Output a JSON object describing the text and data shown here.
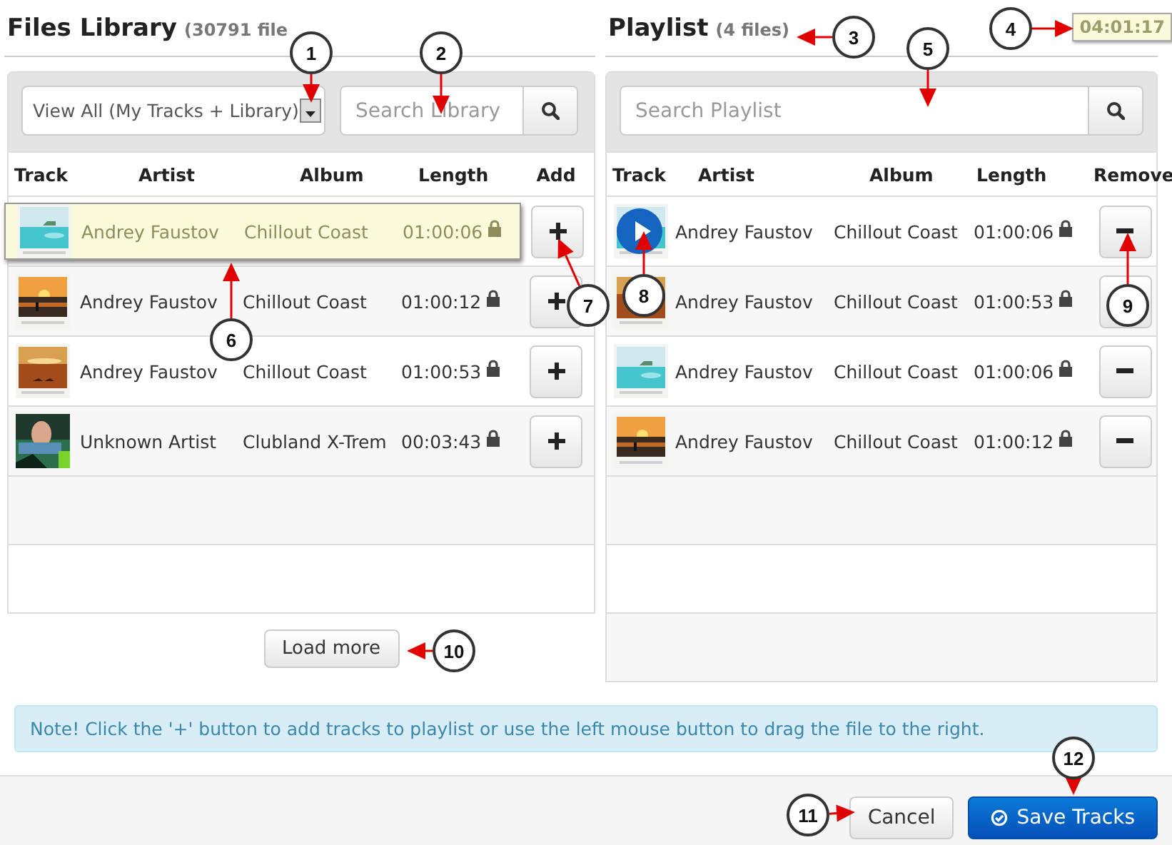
{
  "files_library": {
    "title": "Files Library",
    "count": "(30791 file",
    "filter": {
      "value": "View All (My Tracks + Library)"
    },
    "search": {
      "placeholder": "Search Library"
    },
    "columns": [
      "Track",
      "Artist",
      "Album",
      "Length",
      "Add"
    ],
    "rows": [
      {
        "artist": "Andrey Faustov",
        "album": "Chillout Coast",
        "length": "01:00:06",
        "locked": true,
        "dragging": true
      },
      {
        "artist": "Andrey Faustov",
        "album": "Chillout Coast",
        "length": "01:00:12",
        "locked": true,
        "dragging": false
      },
      {
        "artist": "Andrey Faustov",
        "album": "Chillout Coast",
        "length": "01:00:53",
        "locked": true,
        "dragging": false
      },
      {
        "artist": "Unknown Artist",
        "album": "Clubland X-Trem",
        "length": "00:03:43",
        "locked": true,
        "dragging": false
      }
    ],
    "load_more": "Load more"
  },
  "playlist": {
    "title": "Playlist",
    "count": "(4 files)",
    "total": "04:01:17",
    "search": {
      "placeholder": "Search Playlist"
    },
    "columns": [
      "Track",
      "Artist",
      "Album",
      "Length",
      "Remove"
    ],
    "rows": [
      {
        "artist": "Andrey Faustov",
        "album": "Chillout Coast",
        "length": "01:00:06",
        "locked": true,
        "hovered": true
      },
      {
        "artist": "Andrey Faustov",
        "album": "Chillout Coast",
        "length": "01:00:53",
        "locked": true,
        "hovered": false
      },
      {
        "artist": "Andrey Faustov",
        "album": "Chillout Coast",
        "length": "01:00:06",
        "locked": true,
        "hovered": false
      },
      {
        "artist": "Andrey Faustov",
        "album": "Chillout Coast",
        "length": "01:00:12",
        "locked": true,
        "hovered": false
      }
    ]
  },
  "note": "Note! Click the '+' button to add tracks to playlist or use the left mouse button to drag the file to the right.",
  "buttons": [
    {
      "label": "Cancel",
      "kind": "default"
    },
    {
      "label": "Save Tracks",
      "kind": "primary"
    }
  ],
  "callouts": [
    "1",
    "2",
    "3",
    "4",
    "5",
    "6",
    "7",
    "8",
    "9",
    "10",
    "11",
    "12"
  ]
}
